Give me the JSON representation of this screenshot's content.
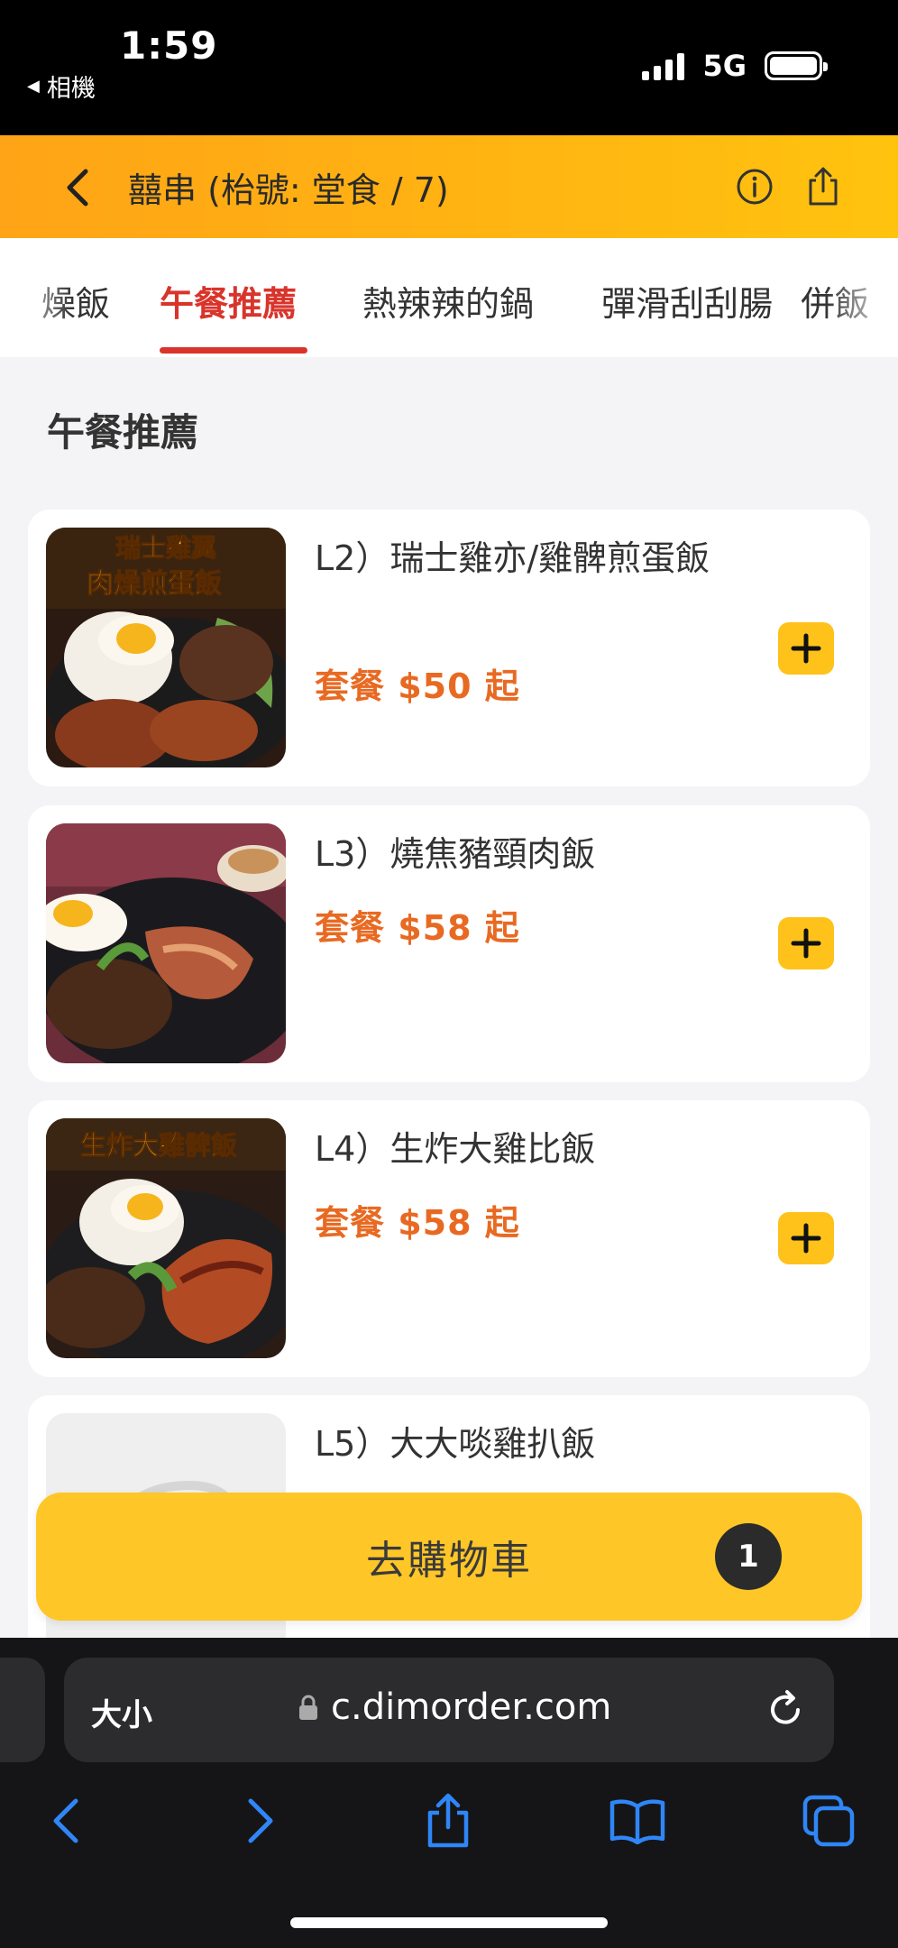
{
  "status_bar": {
    "time": "1:59",
    "back_app": "相機",
    "network": "5G"
  },
  "header": {
    "title": "囍串 (枱號: 堂食 / 7)",
    "back_icon": "chevron-left-icon",
    "info_icon": "info-icon",
    "share_icon": "share-icon"
  },
  "tabs": [
    {
      "label": "燥飯"
    },
    {
      "label": "午餐推薦"
    },
    {
      "label": "熱辣辣的鍋"
    },
    {
      "label": "彈滑刮刮腸"
    },
    {
      "label": "併飯"
    }
  ],
  "section": {
    "title": "午餐推薦"
  },
  "items": [
    {
      "name": "L2）瑞士雞亦/雞髀煎蛋飯",
      "price": "套餐 $50 起",
      "image_caption_1": "瑞士雞翼",
      "image_caption_2": "肉燥煎蛋飯"
    },
    {
      "name": "L3）燒焦豬頸肉飯",
      "price": "套餐 $58 起"
    },
    {
      "name": "L4）生炸大雞比飯",
      "price": "套餐 $58 起",
      "image_caption_1": "生炸大雞髀飯"
    },
    {
      "name": "L5）大大啖雞扒飯"
    }
  ],
  "cart": {
    "label": "去購物車",
    "count": "1"
  },
  "browser": {
    "text_size": "大小",
    "url": "c.dimorder.com"
  },
  "colors": {
    "accent": "#FFC21A",
    "active_tab": "#D9342B",
    "price": "#E86A22"
  }
}
